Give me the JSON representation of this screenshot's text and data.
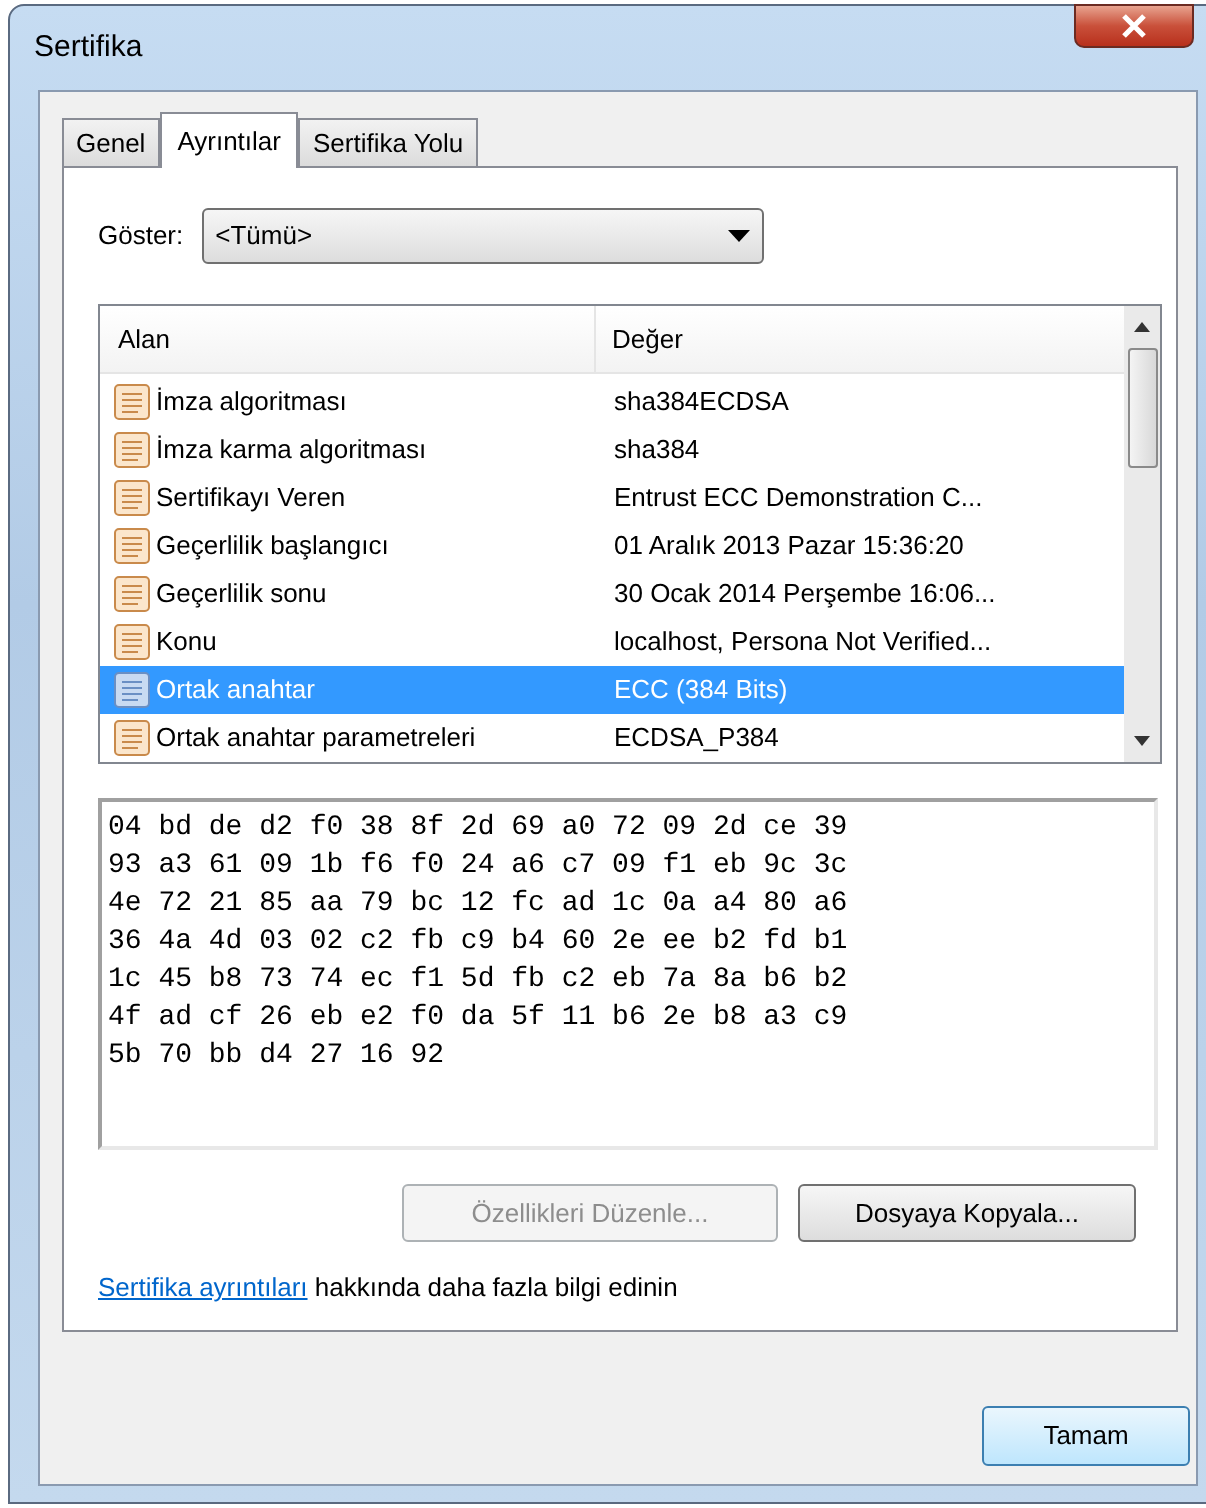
{
  "window": {
    "title": "Sertifika"
  },
  "tabs": [
    {
      "label": "Genel",
      "selected": false
    },
    {
      "label": "Ayrıntılar",
      "selected": true
    },
    {
      "label": "Sertifika Yolu",
      "selected": false
    }
  ],
  "show": {
    "label": "Göster:",
    "value": "<Tümü>"
  },
  "table": {
    "columns": [
      "Alan",
      "Değer"
    ],
    "rows": [
      {
        "field": "İmza algoritması",
        "value": "sha384ECDSA",
        "selected": false
      },
      {
        "field": "İmza karma algoritması",
        "value": "sha384",
        "selected": false
      },
      {
        "field": "Sertifikayı Veren",
        "value": "Entrust ECC Demonstration C...",
        "selected": false
      },
      {
        "field": "Geçerlilik başlangıcı",
        "value": "01 Aralık 2013 Pazar 15:36:20",
        "selected": false
      },
      {
        "field": "Geçerlilik sonu",
        "value": "30 Ocak 2014 Perşembe 16:06...",
        "selected": false
      },
      {
        "field": "Konu",
        "value": "localhost, Persona Not Verified...",
        "selected": false
      },
      {
        "field": "Ortak anahtar",
        "value": "ECC (384 Bits)",
        "selected": true
      },
      {
        "field": "Ortak anahtar parametreleri",
        "value": "ECDSA_P384",
        "selected": false
      }
    ]
  },
  "detail_lines": [
    "04 bd de d2 f0 38 8f 2d 69 a0 72 09 2d ce 39",
    "93 a3 61 09 1b f6 f0 24 a6 c7 09 f1 eb 9c 3c",
    "4e 72 21 85 aa 79 bc 12 fc ad 1c 0a a4 80 a6",
    "36 4a 4d 03 02 c2 fb c9 b4 60 2e ee b2 fd b1",
    "1c 45 b8 73 74 ec f1 5d fb c2 eb 7a 8a b6 b2",
    "4f ad cf 26 eb e2 f0 da 5f 11 b6 2e b8 a3 c9",
    "5b 70 bb d4 27 16 92"
  ],
  "buttons": [
    {
      "label": "Özellikleri Düzenle...",
      "disabled": true
    },
    {
      "label": "Dosyaya Kopyala...",
      "disabled": false
    }
  ],
  "info": {
    "link": "Sertifika ayrıntıları",
    "text": "hakkında daha fazla bilgi edinin"
  },
  "ok_button": "Tamam"
}
